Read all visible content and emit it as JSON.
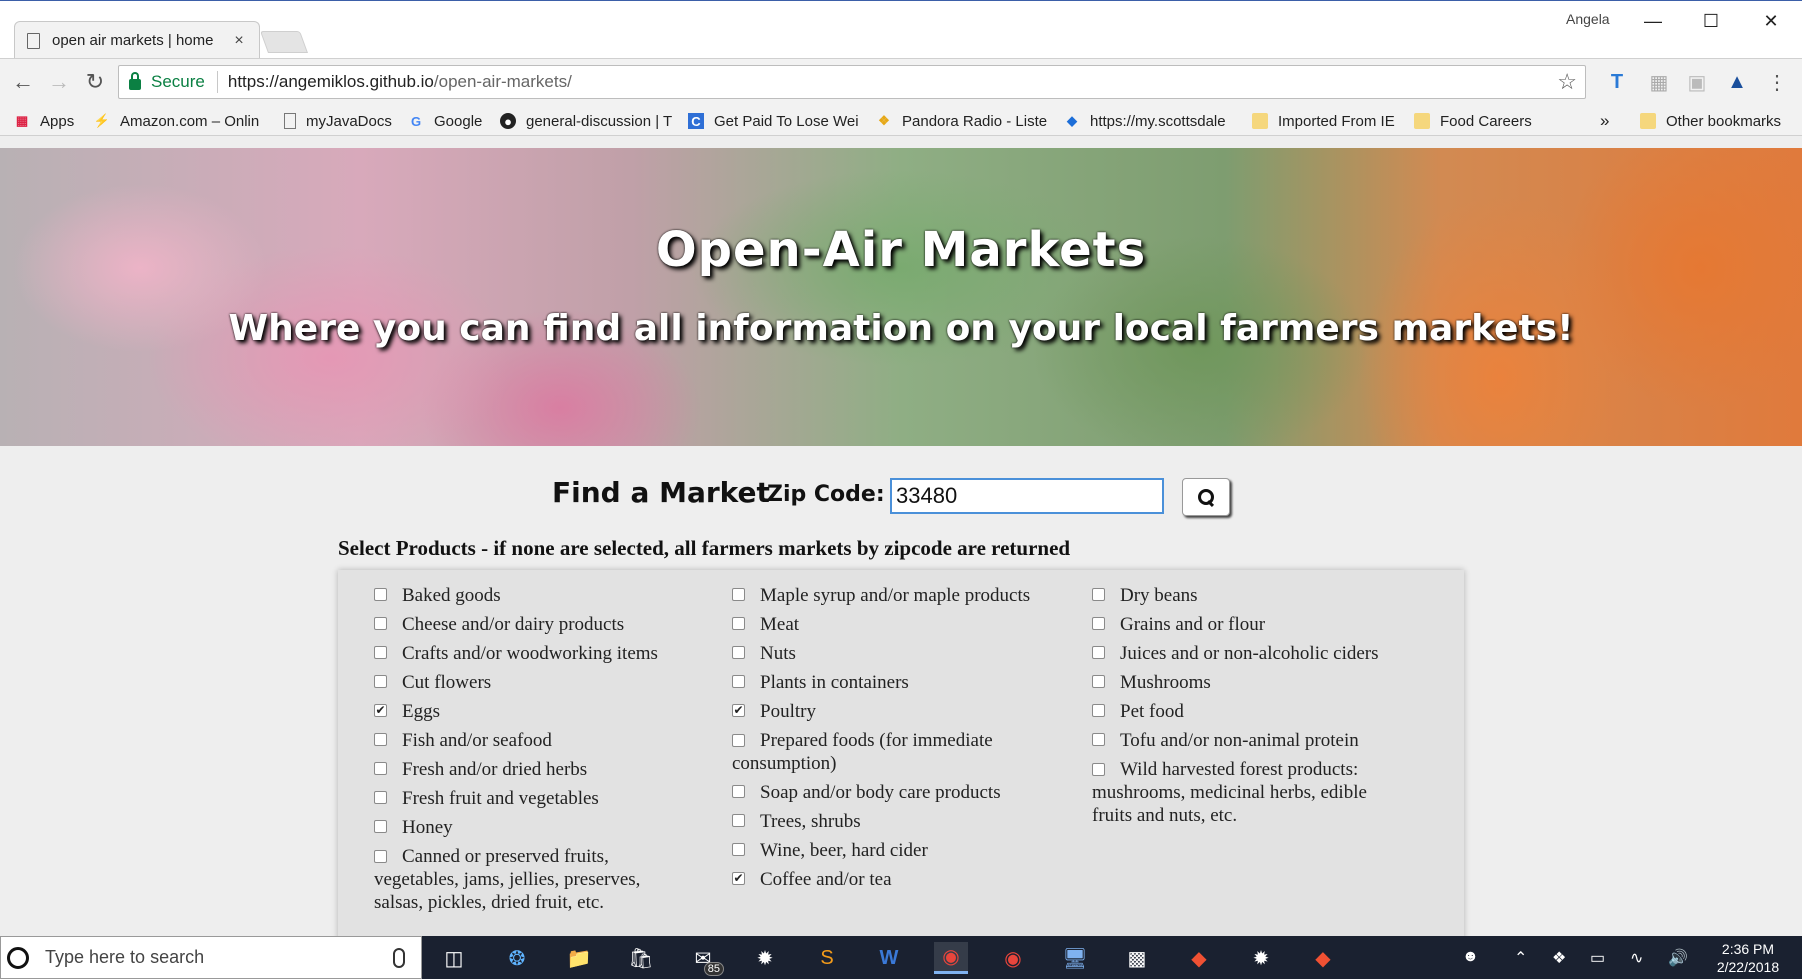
{
  "browser": {
    "tab_title": "open air markets | home",
    "tab_close": "×",
    "user_name": "Angela",
    "window_controls": {
      "minimize": "—",
      "maximize": "☐",
      "close": "✕"
    },
    "secure_label": "Secure",
    "url_host": "https://angemiklos.github.io",
    "url_path": "/open-air-markets/",
    "bookmarks": [
      {
        "label": "Apps",
        "icon": "apps-grid-icon"
      },
      {
        "label": "Amazon.com – Onlin",
        "icon": "amazon-icon"
      },
      {
        "label": "myJavaDocs",
        "icon": "page-icon"
      },
      {
        "label": "Google",
        "icon": "google-icon"
      },
      {
        "label": "general-discussion | T",
        "icon": "github-icon"
      },
      {
        "label": "Get Paid To Lose Wei",
        "icon": "c-icon"
      },
      {
        "label": "Pandora Radio - Liste",
        "icon": "pandora-icon"
      },
      {
        "label": "https://my.scottsdale",
        "icon": "diamond-icon"
      },
      {
        "label": "Imported From IE",
        "icon": "folder-icon"
      },
      {
        "label": "Food Careers",
        "icon": "folder-icon"
      }
    ],
    "overflow_label": "»",
    "other_bookmarks": "Other bookmarks"
  },
  "hero": {
    "title": "Open-Air Markets",
    "subtitle": "Where you can find all information on your local farmers markets!"
  },
  "search": {
    "find_label": "Find a Market",
    "zip_label": "Zip Code:",
    "zip_value": "33480"
  },
  "products": {
    "heading": "Select Products - if none are selected, all farmers markets by zipcode are returned",
    "columns": [
      [
        {
          "label": "Baked goods",
          "checked": false
        },
        {
          "label": "Cheese and/or dairy products",
          "checked": false
        },
        {
          "label": "Crafts and/or woodworking items",
          "checked": false
        },
        {
          "label": "Cut flowers",
          "checked": false
        },
        {
          "label": "Eggs",
          "checked": true
        },
        {
          "label": "Fish and/or seafood",
          "checked": false
        },
        {
          "label": "Fresh and/or dried herbs",
          "checked": false
        },
        {
          "label": "Fresh fruit and vegetables",
          "checked": false
        },
        {
          "label": "Honey",
          "checked": false
        },
        {
          "label": "Canned or preserved fruits, vegetables, jams, jellies, preserves, salsas, pickles, dried fruit, etc.",
          "checked": false
        }
      ],
      [
        {
          "label": "Maple syrup and/or maple products",
          "checked": false
        },
        {
          "label": "Meat",
          "checked": false
        },
        {
          "label": "Nuts",
          "checked": false
        },
        {
          "label": "Plants in containers",
          "checked": false
        },
        {
          "label": "Poultry",
          "checked": true
        },
        {
          "label": "Prepared foods (for immediate consumption)",
          "checked": false
        },
        {
          "label": "Soap and/or body care products",
          "checked": false
        },
        {
          "label": "Trees, shrubs",
          "checked": false
        },
        {
          "label": "Wine, beer, hard cider",
          "checked": false
        },
        {
          "label": "Coffee and/or tea",
          "checked": true
        }
      ],
      [
        {
          "label": "Dry beans",
          "checked": false
        },
        {
          "label": "Grains and or flour",
          "checked": false
        },
        {
          "label": "Juices and or non-alcoholic ciders",
          "checked": false
        },
        {
          "label": "Mushrooms",
          "checked": false
        },
        {
          "label": "Pet food",
          "checked": false
        },
        {
          "label": "Tofu and/or non-animal protein",
          "checked": false
        },
        {
          "label": "Wild harvested forest products: mushrooms, medicinal herbs, edible fruits and nuts, etc.",
          "checked": false
        }
      ]
    ]
  },
  "taskbar": {
    "search_placeholder": "Type here to search",
    "mail_badge": "85",
    "time": "2:36 PM",
    "date": "2/22/2018"
  }
}
